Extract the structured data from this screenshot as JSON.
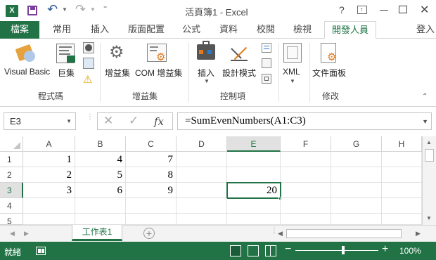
{
  "window": {
    "title": "活頁簿1 - Excel",
    "help": "?"
  },
  "tabs": {
    "file": "檔案",
    "home": "常用",
    "insert": "插入",
    "layout": "版面配置",
    "formulas": "公式",
    "data": "資料",
    "review": "校閱",
    "view": "檢視",
    "developer": "開發人員",
    "signin": "登入"
  },
  "ribbon": {
    "visual_basic": "Visual Basic",
    "macros": "巨集",
    "addins": "增益集",
    "com_addins": "COM 增益集",
    "insert": "插入",
    "design_mode": "設計模式",
    "xml": "XML",
    "doc_panel": "文件面板",
    "group_code": "程式碼",
    "group_addins": "增益集",
    "group_controls": "控制項",
    "group_modify": "修改"
  },
  "formula_bar": {
    "name_box": "E3",
    "formula": "=SumEvenNumbers(A1:C3)",
    "fx": "fx"
  },
  "grid": {
    "columns": [
      "A",
      "B",
      "C",
      "D",
      "E",
      "F",
      "G",
      "H"
    ],
    "rows": [
      "1",
      "2",
      "3",
      "4",
      "5"
    ],
    "cells": {
      "A1": "1",
      "B1": "4",
      "C1": "7",
      "A2": "2",
      "B2": "5",
      "C2": "8",
      "A3": "3",
      "B3": "6",
      "C3": "9",
      "E3": "20"
    }
  },
  "sheets": {
    "active": "工作表1"
  },
  "status": {
    "ready": "就緒",
    "zoom": "100%"
  },
  "colors": {
    "excel_green": "#217346",
    "tab_active": "#217346"
  }
}
